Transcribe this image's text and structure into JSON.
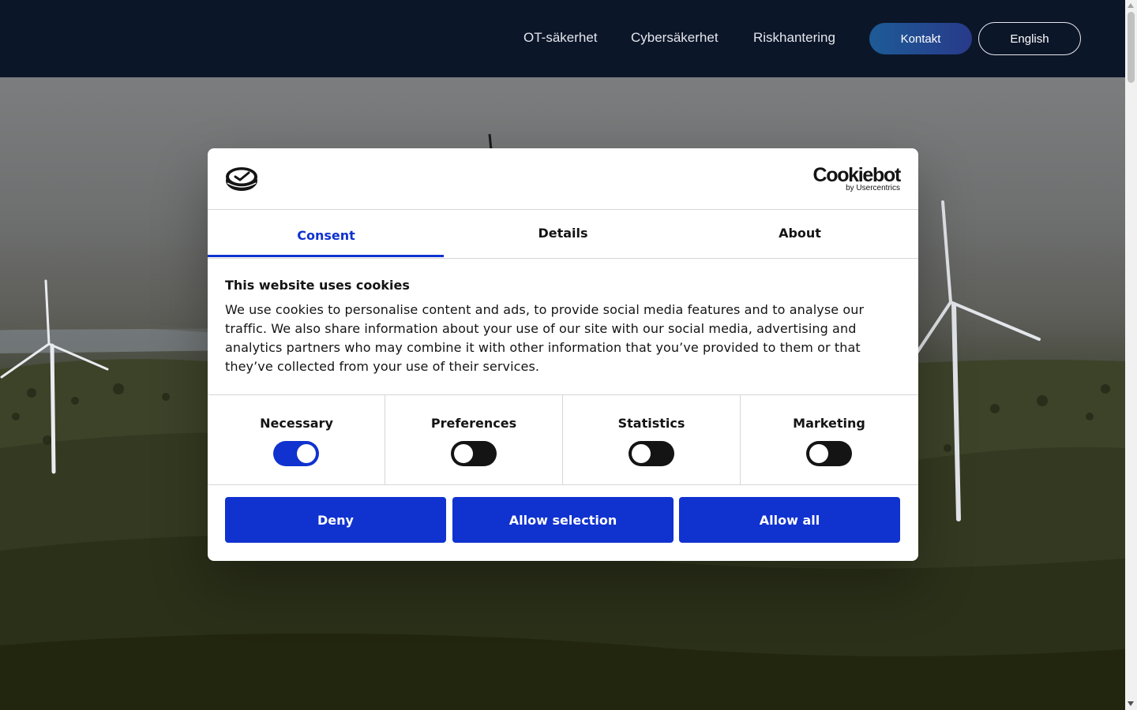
{
  "nav": {
    "links": [
      "OT-säkerhet",
      "Cybersäkerhet",
      "Riskhantering"
    ],
    "contact_label": "Kontakt",
    "language_label": "English"
  },
  "cookie_dialog": {
    "brand": "Cookiebot",
    "brand_sub": "by Usercentrics",
    "tabs": [
      {
        "label": "Consent",
        "active": true
      },
      {
        "label": "Details",
        "active": false
      },
      {
        "label": "About",
        "active": false
      }
    ],
    "title": "This website uses cookies",
    "body": "We use cookies to personalise content and ads, to provide social media features and to analyse our traffic. We also share information about your use of our site with our social media, advertising and analytics partners who may combine it with other information that you’ve provided to them or that they’ve collected from your use of their services.",
    "toggles": [
      {
        "label": "Necessary",
        "checked": true
      },
      {
        "label": "Preferences",
        "checked": false
      },
      {
        "label": "Statistics",
        "checked": false
      },
      {
        "label": "Marketing",
        "checked": false
      }
    ],
    "buttons": {
      "deny": "Deny",
      "allow_selection": "Allow selection",
      "allow_all": "Allow all"
    }
  },
  "colors": {
    "header_bg": "#0c1629",
    "accent": "#1032cf",
    "switch_off": "#141414"
  }
}
